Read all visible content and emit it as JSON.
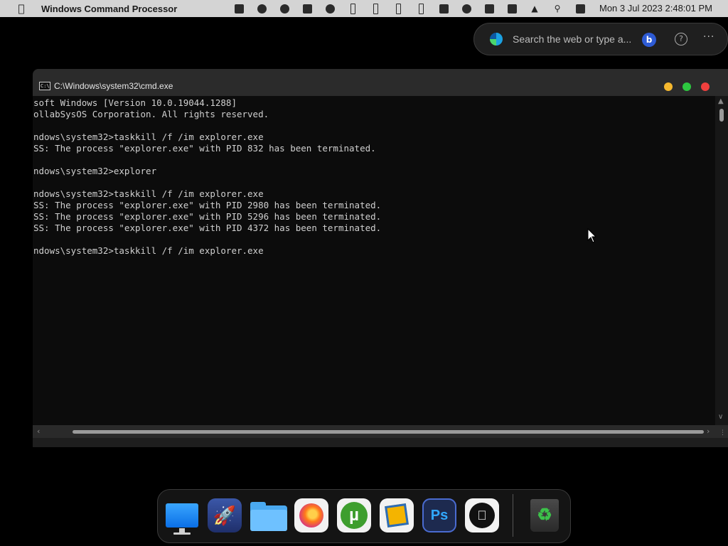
{
  "menubar": {
    "app_title": "Windows Command Processor",
    "clock": "Mon 3 Jul 2023  2:48:01 PM",
    "tray_icons": [
      "taskbar-icon",
      "wordpress-icon",
      "obs-icon",
      "copy-icon",
      "eject-icon",
      "memory-meter-icon",
      "disk-meter-icon",
      "cpu-meter-icon",
      "battery-meter-icon",
      "sidebar-icon",
      "cloud-icon",
      "display-icon",
      "mute-icon",
      "upload-icon",
      "search-icon",
      "control-center-icon"
    ]
  },
  "search": {
    "placeholder": "Search the web or type a...",
    "bing_label": "b",
    "help_label": "?",
    "more_label": "···"
  },
  "window": {
    "title": "C:\\Windows\\system32\\cmd.exe",
    "console_lines": [
      "soft Windows [Version 10.0.19044.1288]",
      "ollabSysOS Corporation. All rights reserved.",
      "",
      "ndows\\system32>taskkill /f /im explorer.exe",
      "SS: The process \"explorer.exe\" with PID 832 has been terminated.",
      "",
      "ndows\\system32>explorer",
      "",
      "ndows\\system32>taskkill /f /im explorer.exe",
      "SS: The process \"explorer.exe\" with PID 2980 has been terminated.",
      "SS: The process \"explorer.exe\" with PID 5296 has been terminated.",
      "SS: The process \"explorer.exe\" with PID 4372 has been terminated.",
      "",
      "ndows\\system32>taskkill /f /im explorer.exe"
    ]
  },
  "dock": {
    "apps": [
      "monitor-app",
      "launchpad-rocket-app",
      "files-folder-app",
      "firefox-app",
      "utorrent-app",
      "virtualbox-app",
      "photoshop-app",
      "apple-app",
      "trash-app"
    ],
    "photoshop_label": "Ps",
    "utorrent_label": "µ"
  },
  "colors": {
    "menubar_bg": "#d4d4d4",
    "terminal_bg": "#0c0c0c",
    "titlebar_bg": "#2b2b2b",
    "traffic_min": "#f5b82e",
    "traffic_max": "#2dc840",
    "traffic_close": "#f0403e"
  }
}
